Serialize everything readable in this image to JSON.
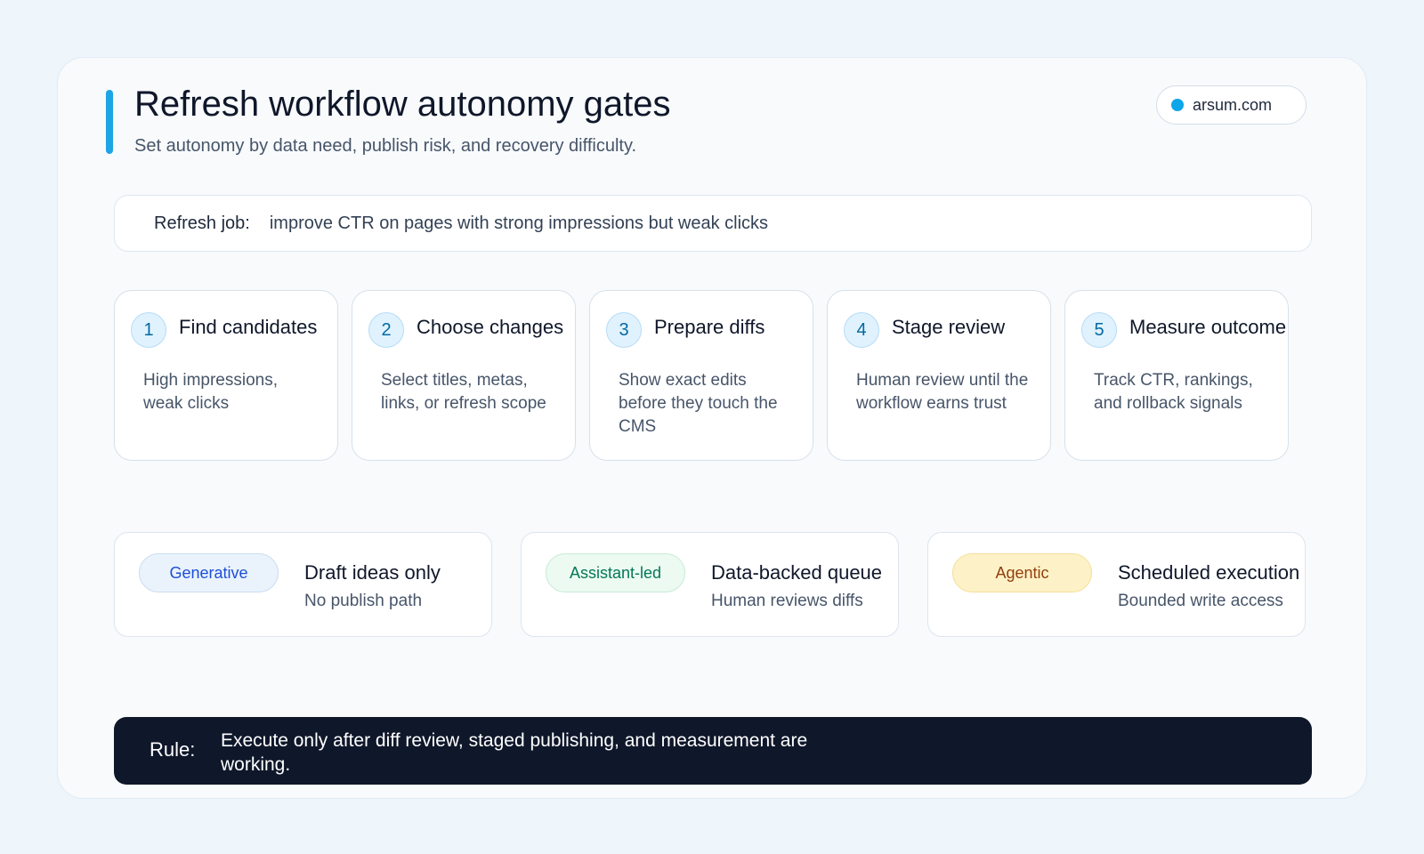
{
  "header": {
    "title": "Refresh workflow autonomy gates",
    "subtitle": "Set autonomy by data need, publish risk, and recovery difficulty.",
    "domain": "arsum.com",
    "accent_color": "#1ea5e4"
  },
  "job": {
    "label": "Refresh job:",
    "text": "improve CTR on pages with strong impressions but weak clicks"
  },
  "steps": [
    {
      "num": "1",
      "title": "Find candidates",
      "desc": "High impressions, weak clicks"
    },
    {
      "num": "2",
      "title": "Choose changes",
      "desc": "Select titles, metas, links, or refresh scope"
    },
    {
      "num": "3",
      "title": "Prepare diffs",
      "desc": "Show exact edits before they touch the CMS"
    },
    {
      "num": "4",
      "title": "Stage review",
      "desc": "Human review until the workflow earns trust"
    },
    {
      "num": "5",
      "title": "Measure outcome",
      "desc": "Track CTR, rankings, and rollback signals"
    }
  ],
  "modes": [
    {
      "badge": "Generative",
      "badge_bg": "#eaf3fc",
      "badge_border": "#c9dcef",
      "badge_color": "#1d4ed8",
      "title": "Draft ideas only",
      "sub": "No publish path"
    },
    {
      "badge": "Assistant-led",
      "badge_bg": "#ecfaf2",
      "badge_border": "#c6ebd5",
      "badge_color": "#047857",
      "title": "Data-backed queue",
      "sub": "Human reviews diffs"
    },
    {
      "badge": "Agentic",
      "badge_bg": "#fdf2c7",
      "badge_border": "#f5df98",
      "badge_color": "#92400e",
      "title": "Scheduled execution",
      "sub": "Bounded write access"
    }
  ],
  "rule": {
    "label": "Rule:",
    "text": "Execute only after diff review, staged publishing, and measurement are working."
  }
}
